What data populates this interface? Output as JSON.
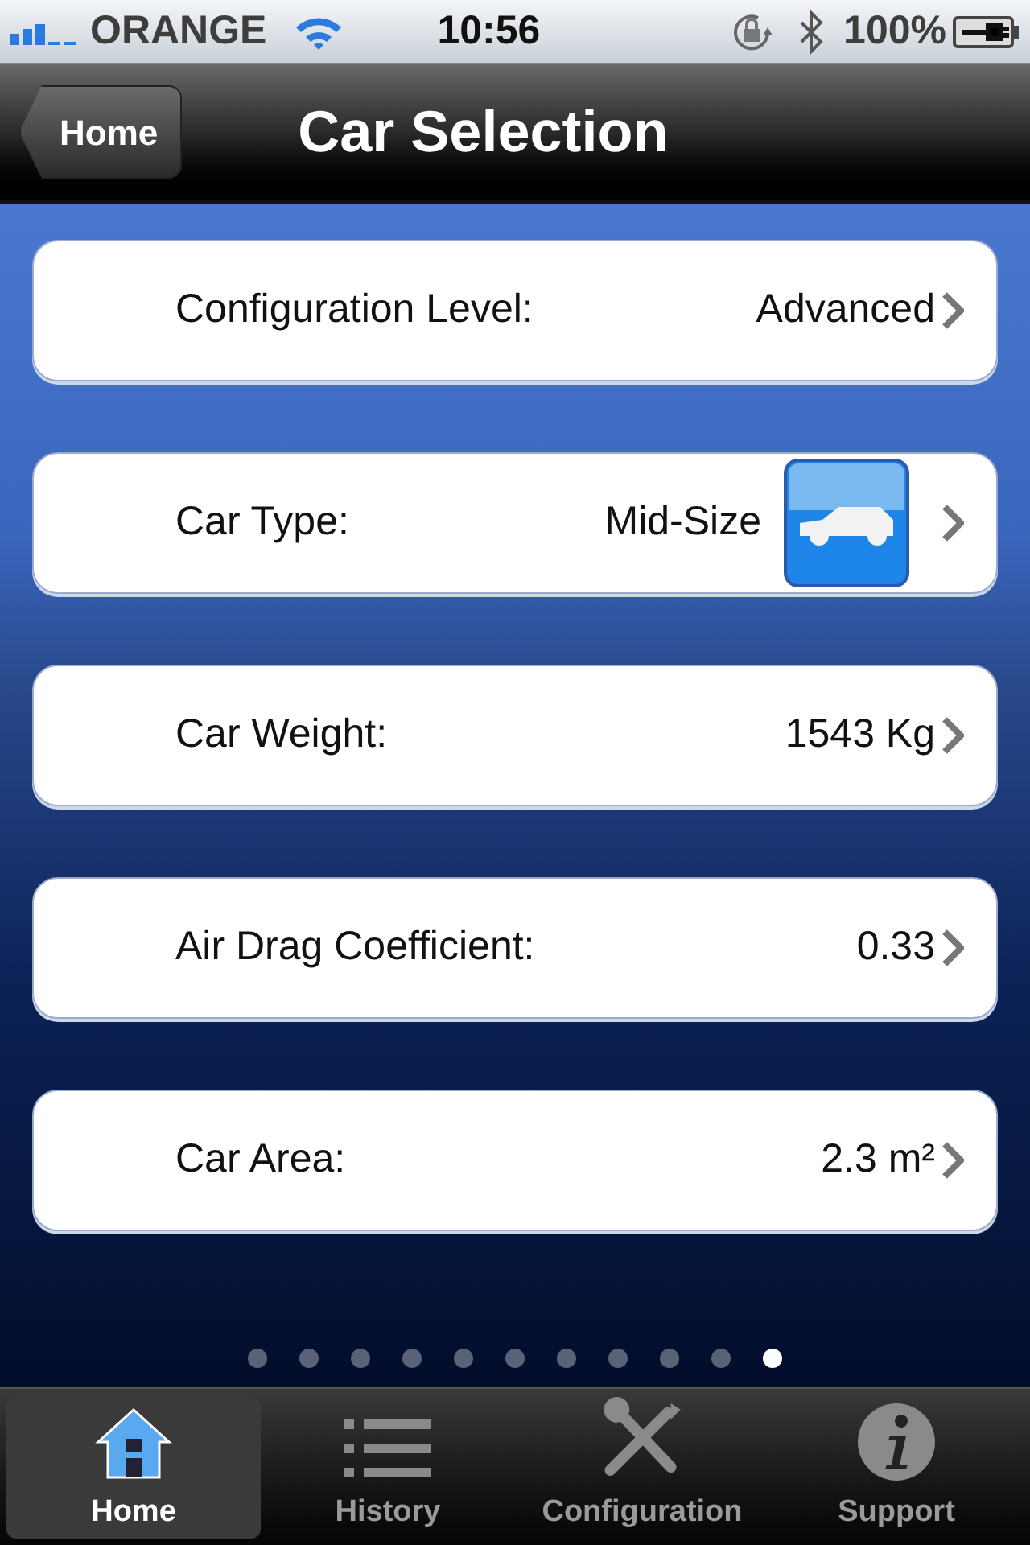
{
  "status_bar": {
    "carrier": "ORANGE",
    "time": "10:56",
    "battery": "100%"
  },
  "nav_bar": {
    "back_button": "Home",
    "title": "Car Selection"
  },
  "rows": [
    {
      "kind": "plain",
      "label": "Configuration Level:",
      "value": "Advanced"
    },
    {
      "kind": "with-image",
      "label": "Car Type:",
      "value": "Mid-Size"
    },
    {
      "kind": "plain",
      "label": "Car Weight:",
      "value": "1543 Kg"
    },
    {
      "kind": "plain",
      "label": "Air Drag Coefficient:",
      "value": "0.33"
    },
    {
      "kind": "plain",
      "label": "Car Area:",
      "value": "2.3 m²"
    }
  ],
  "page_dots": [
    {
      "selected": false
    },
    {
      "selected": false
    },
    {
      "selected": false
    },
    {
      "selected": false
    },
    {
      "selected": false
    },
    {
      "selected": false
    },
    {
      "selected": false
    },
    {
      "selected": false
    },
    {
      "selected": false
    },
    {
      "selected": false
    },
    {
      "selected": true
    }
  ],
  "tab_bar": [
    {
      "kind": "home",
      "label": "Home",
      "selected": true
    },
    {
      "kind": "list",
      "label": "History",
      "selected": false
    },
    {
      "kind": "tools",
      "label": "Configuration",
      "selected": false
    },
    {
      "kind": "info",
      "label": "Support",
      "selected": false
    }
  ]
}
